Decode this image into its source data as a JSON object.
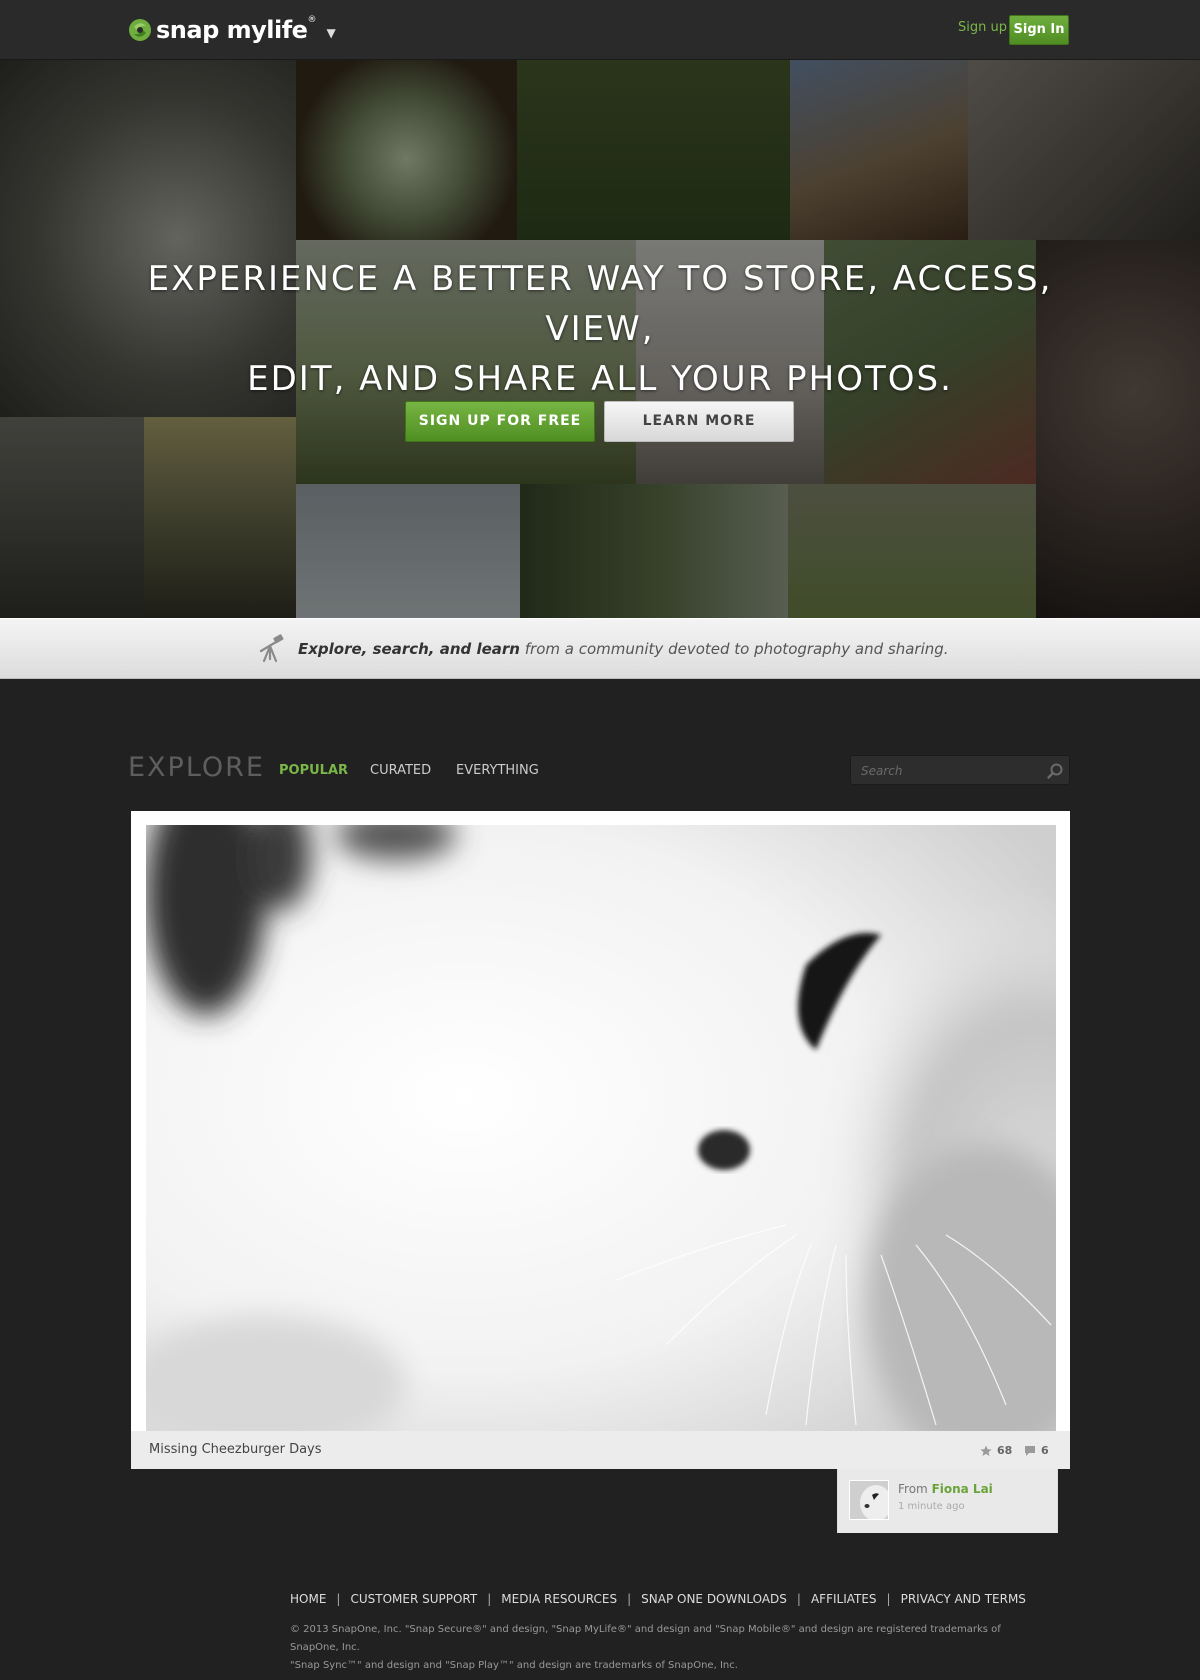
{
  "header": {
    "logo_text": "snap mylife",
    "logo_reg": "®",
    "menu_caret": "▼",
    "signup_label": "Sign up",
    "signin_label": "Sign In",
    "accent": "#7ab648"
  },
  "hero": {
    "headline_line1": "EXPERIENCE A BETTER WAY TO STORE, ACCESS, VIEW,",
    "headline_line2": "EDIT, AND SHARE ALL YOUR PHOTOS.",
    "signup_cta": "SIGN UP FOR FREE",
    "learn_cta": "LEARN MORE"
  },
  "banner": {
    "icon": "telescope-icon",
    "bold_text": "Explore, search, and learn",
    "rest_text": " from a community devoted to photography and sharing."
  },
  "explore": {
    "title": "EXPLORE",
    "tabs": [
      {
        "label": "POPULAR",
        "active": true
      },
      {
        "label": "CURATED",
        "active": false
      },
      {
        "label": "EVERYTHING",
        "active": false
      }
    ],
    "search_placeholder": "Search"
  },
  "photo": {
    "title": "Missing Cheezburger Days",
    "stars": "68",
    "comments": "6",
    "from_label": "From",
    "author": "Fiona Lai",
    "time": "1 minute ago"
  },
  "footer": {
    "links": [
      "HOME",
      "CUSTOMER SUPPORT",
      "MEDIA RESOURCES",
      "SNAP ONE DOWNLOADS",
      "AFFILIATES",
      "PRIVACY AND TERMS"
    ],
    "separator": "|",
    "legal_line1": "© 2013 SnapOne, Inc. \"Snap Secure®\" and design, \"Snap MyLife®\" and design and \"Snap Mobile®\" and design are registered trademarks of SnapOne, Inc.",
    "legal_line2": "\"Snap Sync™\" and design and \"Snap Play™\" and design are trademarks of SnapOne, Inc."
  }
}
